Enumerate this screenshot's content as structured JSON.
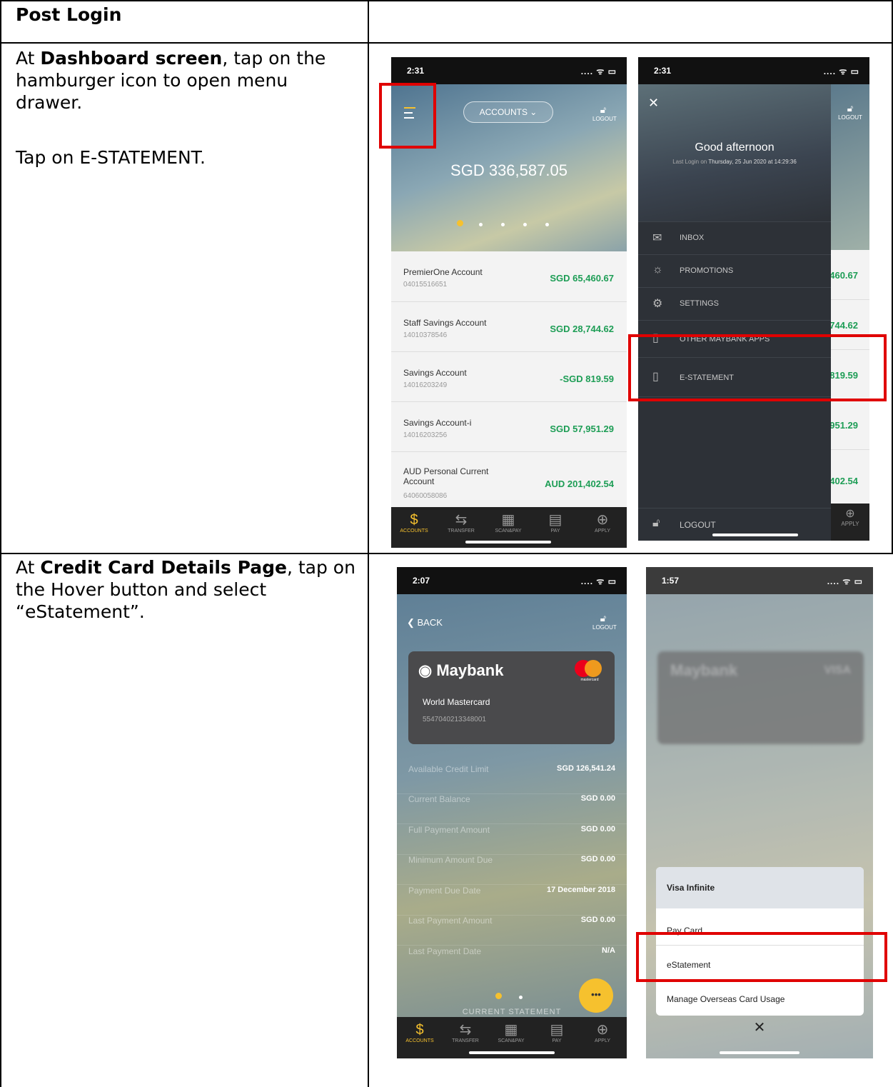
{
  "table": {
    "header": "Post Login",
    "row1": {
      "line1_prefix": "At ",
      "line1_bold": "Dashboard screen",
      "line1_rest": ", tap on the hamburger icon to open menu drawer.",
      "line2": "Tap on E-STATEMENT."
    },
    "row2": {
      "prefix": "At ",
      "bold": "Credit Card Details Page",
      "rest": ", tap on the Hover button and select “eStatement”."
    }
  },
  "colors": {
    "accent_yellow": "#f6c12e",
    "amount_green": "#1d9d55",
    "highlight_red": "#e00000",
    "drawer_bg": "#2d3137"
  },
  "screen_a": {
    "time": "2:31",
    "status_icons": "....  ᯤ ▭",
    "accounts_pill": "ACCOUNTS ⌄",
    "logout": "LOGOUT",
    "balance": "SGD 336,587.05",
    "accounts": [
      {
        "name": "PremierOne Account",
        "number": "04015516651",
        "amount": "SGD 65,460.67"
      },
      {
        "name": "Staff Savings Account",
        "number": "14010378546",
        "amount": "SGD 28,744.62"
      },
      {
        "name": "Savings Account",
        "number": "14016203249",
        "amount": "-SGD 819.59"
      },
      {
        "name": "Savings Account-i",
        "number": "14016203256",
        "amount": "SGD 57,951.29"
      },
      {
        "name": "AUD Personal Current Account",
        "number": "64060058086",
        "amount": "AUD 201,402.54"
      }
    ],
    "tabs": [
      {
        "icon": "$",
        "label": "ACCOUNTS"
      },
      {
        "icon": "⇆",
        "label": "TRANSFER"
      },
      {
        "icon": "▦",
        "label": "SCAN&PAY"
      },
      {
        "icon": "▤",
        "label": "PAY"
      },
      {
        "icon": "⊕",
        "label": "APPLY"
      }
    ]
  },
  "screen_b": {
    "time": "2:31",
    "status_icons": "....  ᯤ ▭",
    "close": "✕",
    "logout_top": "LOGOUT",
    "greeting": "Good afternoon",
    "last_login_prefix": "Last Login on ",
    "last_login_value": "Thursday, 25 Jun 2020 at 14:29:36",
    "menu": [
      {
        "icon": "✉",
        "label": "INBOX"
      },
      {
        "icon": "☼",
        "label": "PROMOTIONS"
      },
      {
        "icon": "⚙",
        "label": "SETTINGS"
      },
      {
        "icon": "▯",
        "label": "OTHER MAYBANK APPS"
      },
      {
        "icon": "▯",
        "label": "E-STATEMENT"
      }
    ],
    "logout_bottom": "LOGOUT",
    "peek_amounts": [
      "460.67",
      "744.62",
      "819.59",
      "951.29",
      "402.54"
    ],
    "apply": "APPLY"
  },
  "screen_c": {
    "time": "2:07",
    "status_icons": "....  ᯤ ▭",
    "back": "BACK",
    "logout": "LOGOUT",
    "bank": "Maybank",
    "card_name": "World Mastercard",
    "card_number": "5547040213348001",
    "brand_small": "mastercard",
    "details": [
      {
        "label": "Available Credit Limit",
        "value": "SGD 126,541.24"
      },
      {
        "label": "Current Balance",
        "value": "SGD 0.00"
      },
      {
        "label": "Full Payment Amount",
        "value": "SGD 0.00"
      },
      {
        "label": "Minimum Amount Due",
        "value": "SGD 0.00"
      },
      {
        "label": "Payment Due Date",
        "value": "17 December 2018"
      },
      {
        "label": "Last Payment Amount",
        "value": "SGD 0.00"
      },
      {
        "label": "Last Payment Date",
        "value": "N/A"
      }
    ],
    "current_statement": "CURRENT STATEMENT",
    "fab": "•••",
    "tabs": [
      {
        "icon": "$",
        "label": "ACCOUNTS"
      },
      {
        "icon": "⇆",
        "label": "TRANSFER"
      },
      {
        "icon": "▦",
        "label": "SCAN&PAY"
      },
      {
        "icon": "▤",
        "label": "PAY"
      },
      {
        "icon": "⊕",
        "label": "APPLY"
      }
    ]
  },
  "screen_d": {
    "time": "1:57",
    "status_icons": "....  ᯤ ▭",
    "bank_blur": "Maybank",
    "brand_blur": "VISA",
    "sheet_title": "Visa Infinite",
    "options": [
      "Pay Card",
      "eStatement",
      "Manage Overseas Card Usage"
    ],
    "close": "✕"
  }
}
